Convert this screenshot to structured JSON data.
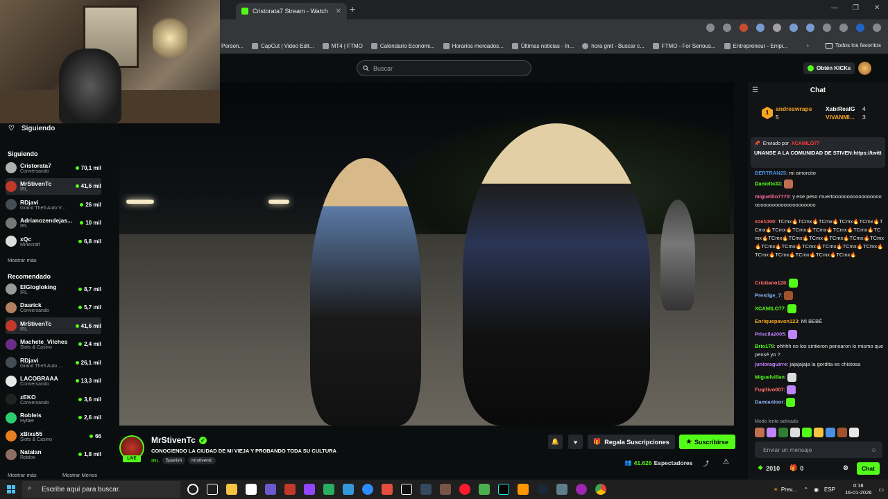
{
  "browser": {
    "tabs": [
      {
        "label": "Cristorata7 Stream - Watch Live"
      }
    ],
    "bookmarks": [
      {
        "label": "Person..."
      },
      {
        "label": "CapCut | Video Edit..."
      },
      {
        "label": "MT4 | FTMO"
      },
      {
        "label": "Calendario Económi..."
      },
      {
        "label": "Horarios mercados..."
      },
      {
        "label": "Últimas noticias - In..."
      },
      {
        "label": "hora gmt - Buscar c..."
      },
      {
        "label": "FTMO - For Serious..."
      },
      {
        "label": "Entrepreneur - Empi..."
      }
    ],
    "all_bookmarks": "Todos los favoritos"
  },
  "header": {
    "search_placeholder": "Buscar",
    "kicks_label": "Obtén KICKs"
  },
  "sidebar": {
    "following_title": "Siguiendo",
    "section_following": "Siguiendo",
    "following": [
      {
        "name": "Cristorata7",
        "category": "Conversando",
        "viewers": "70,1 mil",
        "color": "#b0b0b0"
      },
      {
        "name": "MrStivenTc",
        "category": "IRL",
        "viewers": "41,6 mil",
        "color": "#c0392b"
      },
      {
        "name": "RDjavi",
        "category": "Grand Theft Auto V...",
        "viewers": "26 mil",
        "color": "#444c55"
      },
      {
        "name": "Adrianozendejas...",
        "category": "IRL",
        "viewers": "10 mil",
        "color": "#777"
      },
      {
        "name": "xQc",
        "category": "Minecraft",
        "viewers": "6,8 mil",
        "color": "#ddd"
      }
    ],
    "show_more": "Mostrar más",
    "section_recommended": "Recomendado",
    "recommended": [
      {
        "name": "ElGlogloking",
        "category": "IRL",
        "viewers": "8,7 mil",
        "color": "#999"
      },
      {
        "name": "Daarick",
        "category": "Conversando",
        "viewers": "5,7 mil",
        "color": "#b08060"
      },
      {
        "name": "MrStivenTc",
        "category": "IRL",
        "viewers": "41,6 mil",
        "color": "#c0392b"
      },
      {
        "name": "Machete_Vilches",
        "category": "Slots & Casino",
        "viewers": "2,4 mil",
        "color": "#6a2d8a"
      },
      {
        "name": "RDjavi",
        "category": "Grand Theft Auto ...",
        "viewers": "26,1 mil",
        "color": "#444c55"
      },
      {
        "name": "LACOBRAAA",
        "category": "Conversando",
        "viewers": "13,3 mil",
        "color": "#e8e8e8"
      },
      {
        "name": "zEKO",
        "category": "Conversando",
        "viewers": "3,6 mil",
        "color": "#222"
      },
      {
        "name": "Robleis",
        "category": "Hytale",
        "viewers": "2,6 mil",
        "color": "#2ecc71"
      },
      {
        "name": "xBixs55",
        "category": "Slots & Casino",
        "viewers": "66",
        "color": "#e67e22"
      },
      {
        "name": "Natalan",
        "category": "Roblox",
        "viewers": "1,8 mil",
        "color": "#8d6e63"
      }
    ],
    "show_more_2": "Mostrar más",
    "show_less": "Mostrar Menos"
  },
  "stream": {
    "channel": "MrStivenTc",
    "live_label": "LIVE",
    "title": "CONOCIENDO LA CIUDAD DE MI VIEJA Y PROBANDO TODA SU CULTURA",
    "category": "IRL",
    "tags": [
      "Spanish",
      "mrstiventc"
    ],
    "gift_label": "Regala Suscripciones",
    "subscribe_label": "Suscribirse",
    "viewers": "41.626",
    "viewers_label": "Espectadores"
  },
  "chat": {
    "title": "Chat",
    "leaderboard": [
      {
        "name": "andreswraps",
        "count": "5",
        "color": "#f5a623"
      },
      {
        "name": "XabiRealG",
        "count": "4",
        "color": "#ffffff"
      },
      {
        "name": "VIVANMI...",
        "count": "3",
        "color": "#f5a623"
      }
    ],
    "pinned_by": "Enviado por",
    "pinned_user": "XCAMILO77",
    "pinned_message": "UNANSE A LA COMUNIDAD DE STIVEN:https://twitter.com/i/communi...",
    "messages": [
      {
        "user": "BERTRAN25",
        "text": ": mi amorcito",
        "color": "#4a90e2"
      },
      {
        "user": "Danieltc33",
        "text": ":",
        "color": "#53fc18"
      },
      {
        "user": "miguelito7770",
        "text": ": y ese peso muertoooooooooooooooooooooooooooooooooooooo",
        "color": "#ff6b9d"
      },
      {
        "user": "zoe1000",
        "text": ": TCmx🔥TCmx🔥TCmx🔥TCmx🔥TCmx🔥TCmx🔥TCmx🔥TCmx🔥TCmx🔥TCmx🔥TCmx🔥TCmx🔥TCmx🔥TCmx🔥TCmx🔥TCmx🔥TCmx🔥TCmx🔥TCmx🔥TCmx🔥TCmx🔥TCmx🔥TCmx🔥TCmx🔥TCmx🔥TCmx🔥TCmx🔥TCmx🔥TCmx🔥",
        "color": "#ff6b6b"
      },
      {
        "user": "Cristiano128",
        "text": ":",
        "color": "#ff6b6b"
      },
      {
        "user": "Prestige_7",
        "text": ":",
        "color": "#8ab4f8"
      },
      {
        "user": "XCAMILO77",
        "text": ":",
        "color": "#53fc18"
      },
      {
        "user": "Enriquepavon123",
        "text": ": MI BEBÉ",
        "color": "#f5a623"
      },
      {
        "user": "Priscila2005",
        "text": ":",
        "color": "#c084fc"
      },
      {
        "user": "Brio178",
        "text": ": ohhhh no los sintieron pensaron lo mismo que pensé yo ?",
        "color": "#53fc18"
      },
      {
        "user": "junioraguirre",
        "text": ": jajajajaja la gordita es chistosa",
        "color": "#c084fc"
      },
      {
        "user": "Miguelvillan",
        "text": ":",
        "color": "#53fc18"
      },
      {
        "user": "Fugitivo007",
        "text": ":",
        "color": "#ff6b6b"
      },
      {
        "user": "Damianloor",
        "text": ":",
        "color": "#8ab4f8"
      }
    ],
    "slow_mode": "Modo lento activado",
    "input_placeholder": "Enviar un mensaje",
    "points": "2010",
    "gifts": "0",
    "chat_button": "Chat"
  },
  "taskbar": {
    "search_placeholder": "Escribe aquí para buscar.",
    "weather_app": "Prev...",
    "language": "ESP",
    "time": "0:18",
    "date": "16-01-2026"
  }
}
